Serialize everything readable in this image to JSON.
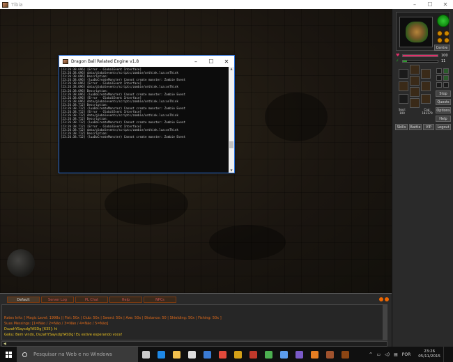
{
  "window": {
    "title": "Tibia",
    "minimize_glyph": "–",
    "maximize_glyph": "☐",
    "close_glyph": "✕"
  },
  "side_panel": {
    "centre_label": "Centre",
    "health_value": "100",
    "mana_value": "11",
    "soul_label": "Soul:",
    "soul_value": "100",
    "cap_label": "Cap:",
    "cap_value": "183179",
    "buttons": {
      "stop": "Stop",
      "quests": "Quests",
      "options": "Options",
      "help": "Help",
      "skills": "Skills",
      "battle": "Battle",
      "vip": "VIP",
      "logout": "Logout"
    },
    "colors": {
      "health": "#e0306a",
      "mana": "#2a9a2a"
    }
  },
  "console": {
    "title": "Dragon Ball Related Engine v1.8",
    "lines": [
      "[23:26:38.696] [Error - GlobalEvent Interface]",
      "[23:26:38.696] data/globalevents/scripts/zombie/onthink.lua:onThink",
      "[23:26:38.696] Description:",
      "[23:26:38.696] (luaDoCreateMonster) Cannot create monster: Zombie Event",
      "",
      "[23:26:38.696] [Error - GlobalEvent Interface]",
      "[23:26:38.696] data/globalevents/scripts/zombie/onthink.lua:onThink",
      "[23:26:38.696] Description:",
      "[23:26:38.696] (luaDoCreateMonster) Cannot create monster: Zombie Event",
      "",
      "[23:26:38.696] [Error - GlobalEvent Interface]",
      "[23:26:38.696] data/globalevents/scripts/zombie/onthink.lua:onThink",
      "[23:26:38.712] Description:",
      "[23:26:38.712] (luaDoCreateMonster) Cannot create monster: Zombie Event",
      "",
      "[23:26:38.712] [Error - GlobalEvent Interface]",
      "[23:26:38.712] data/globalevents/scripts/zombie/onthink.lua:onThink",
      "[23:26:38.712] Description:",
      "[23:26:38.712] (luaDoCreateMonster) Cannot create monster: Zombie Event",
      "",
      "[23:26:38.712] [Error - GlobalEvent Interface]",
      "[23:26:38.712] data/globalevents/scripts/zombie/onthink.lua:onThink",
      "[23:26:38.712] Description:",
      "[23:26:38.712] (luaDoCreateMonster) Cannot create monster: Zombie Event"
    ]
  },
  "chat": {
    "tabs": [
      "Default",
      "Server Log",
      "PL Chat",
      "Help",
      "NPCs"
    ],
    "active_tab": "Default",
    "lines": [
      {
        "text": "Rates Info: [ Magic Level: 1998x || Fist: 50x | Club: 50x | Sword: 50x | Axe: 50x | Distance: 50 | Shielding: 50x | Fishing: 50x ]",
        "color": "#e06a1a"
      },
      {
        "text": "Suas Messings: [1=Não / 2=Não / 3=Não / 4=Não / 5=Não]",
        "color": "#e06a1a"
      },
      {
        "text": "DuzahYSaysdgYASDg [635]: hi",
        "color": "#e8c020"
      },
      {
        "text": "Goku: Bem vindo, DuzahYSaysdgYASDg! Eu estive esperando voce!",
        "color": "#e8c020"
      }
    ]
  },
  "taskbar": {
    "search_placeholder": "Pesquisar na Web e no Windows",
    "language": "POR",
    "time": "23:26",
    "date": "05/11/2015",
    "app_icons": [
      {
        "name": "task-view-icon",
        "color": "#cccccc"
      },
      {
        "name": "edge-icon",
        "color": "#1e88e5"
      },
      {
        "name": "explorer-icon",
        "color": "#f2c14e"
      },
      {
        "name": "store-icon",
        "color": "#dddddd"
      },
      {
        "name": "media-icon",
        "color": "#3a7bd5"
      },
      {
        "name": "chrome-icon",
        "color": "#e24a3b"
      },
      {
        "name": "game-icon",
        "color": "#d4a017"
      },
      {
        "name": "ball-icon",
        "color": "#c0392b"
      },
      {
        "name": "network-icon",
        "color": "#4caf50"
      },
      {
        "name": "notes-icon",
        "color": "#5c9ded"
      },
      {
        "name": "folder-icon",
        "color": "#7a5ac8"
      },
      {
        "name": "app-icon-orange",
        "color": "#e67e22"
      },
      {
        "name": "tibia-icon",
        "color": "#a0522d"
      },
      {
        "name": "tibia-icon-2",
        "color": "#8b4513"
      }
    ]
  }
}
